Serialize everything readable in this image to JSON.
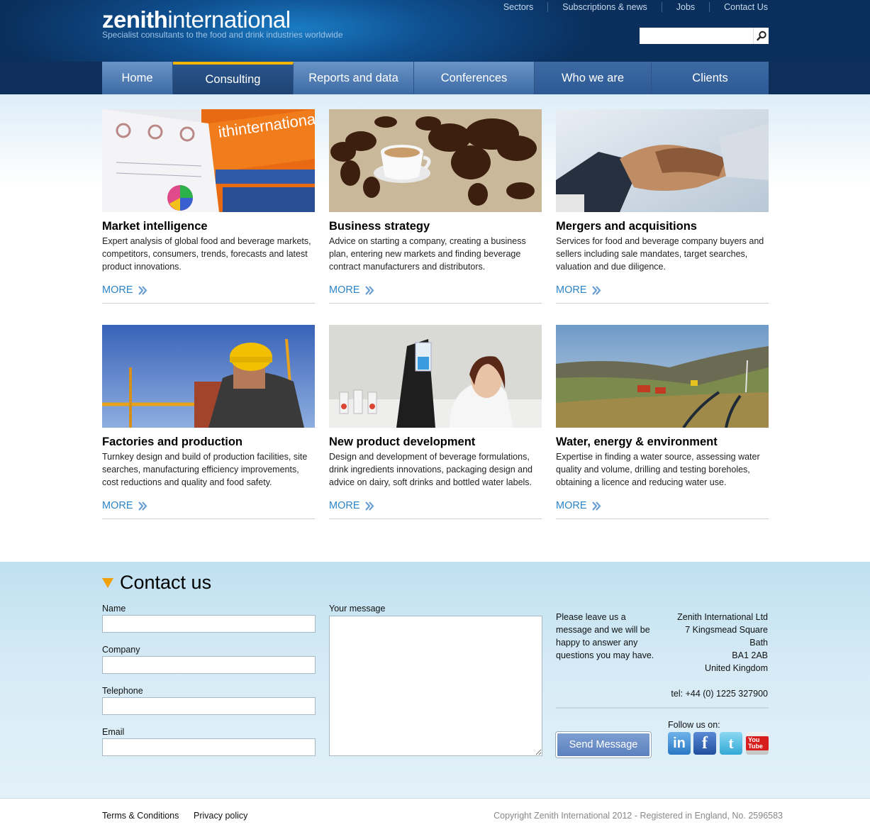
{
  "header": {
    "logo_bold": "zenith",
    "logo_light": "international",
    "tagline": "Specialist consultants to the food and drink industries worldwide",
    "top_links": [
      "Sectors",
      "Subscriptions & news",
      "Jobs",
      "Contact Us"
    ],
    "search_placeholder": ""
  },
  "nav": {
    "items": [
      "Home",
      "Consulting",
      "Reports and data",
      "Conferences",
      "Who we are",
      "Clients"
    ],
    "active": "Consulting"
  },
  "services": [
    {
      "title": "Market intelligence",
      "desc": "Expert analysis of global food and beverage markets, competitors, consumers, trends, forecasts and latest product innovations.",
      "more": "MORE",
      "image": "report-binder-pie-chart-photo"
    },
    {
      "title": "Business strategy",
      "desc": "Advice on starting a company, creating a business plan, entering new markets and finding beverage contract manufacturers and distributors.",
      "more": "MORE",
      "image": "coffee-cup-beans-world-map-photo"
    },
    {
      "title": "Mergers and acquisitions",
      "desc": "Services for food and beverage company buyers and sellers including sale mandates, target searches, valuation and due diligence.",
      "more": "MORE",
      "image": "business-handshake-photo"
    },
    {
      "title": "Factories and production",
      "desc": "Turnkey design and build of production facilities, site searches, manufacturing efficiency improvements, cost reductions and quality and food safety.",
      "more": "MORE",
      "image": "construction-worker-hard-hat-photo"
    },
    {
      "title": "New product development",
      "desc": "Design and development of beverage formulations, drink ingredients innovations, packaging design and advice on dairy, soft drinks and bottled water labels.",
      "more": "MORE",
      "image": "lab-scientist-flask-photo"
    },
    {
      "title": "Water, energy & environment",
      "desc": "Expertise in finding a water source, assessing water quality and volume, drilling and testing boreholes, obtaining a licence and reducing water use.",
      "more": "MORE",
      "image": "hillside-pipeline-landscape-photo"
    }
  ],
  "contact": {
    "heading": "Contact us",
    "fields": {
      "name": {
        "label": "Name",
        "value": ""
      },
      "company": {
        "label": "Company",
        "value": ""
      },
      "telephone": {
        "label": "Telephone",
        "value": ""
      },
      "email": {
        "label": "Email",
        "value": ""
      },
      "message": {
        "label": "Your message",
        "value": ""
      }
    },
    "note": "Please leave us a message and we will be happy to answer any questions you may have.",
    "address": [
      "Zenith International Ltd",
      "7 Kingsmead Square",
      "Bath",
      "BA1 2AB",
      "United Kingdom"
    ],
    "tel": "tel: +44 (0) 1225 327900",
    "send_label": "Send Message",
    "follow_label": "Follow us on:",
    "social": [
      {
        "name": "LinkedIn",
        "text": "in",
        "color": "#3b8ad0"
      },
      {
        "name": "Facebook",
        "text": "f",
        "color": "#2a63b2"
      },
      {
        "name": "Twitter",
        "text": "t",
        "color": "#3cb5dc"
      },
      {
        "name": "YouTube",
        "text": "You Tube",
        "color": "#d8d8d8"
      }
    ]
  },
  "footer": {
    "terms": "Terms & Conditions",
    "privacy": "Privacy policy",
    "copyright": "Copyright Zenith International 2012 - Registered in England, No. 2596583"
  },
  "colors": {
    "header_dark": "#0a2f5c",
    "header_light": "#1a7cc4",
    "nav_active_accent": "#f5b400",
    "link_blue": "#2a84c6",
    "contact_bg": "#d6ebf6"
  }
}
